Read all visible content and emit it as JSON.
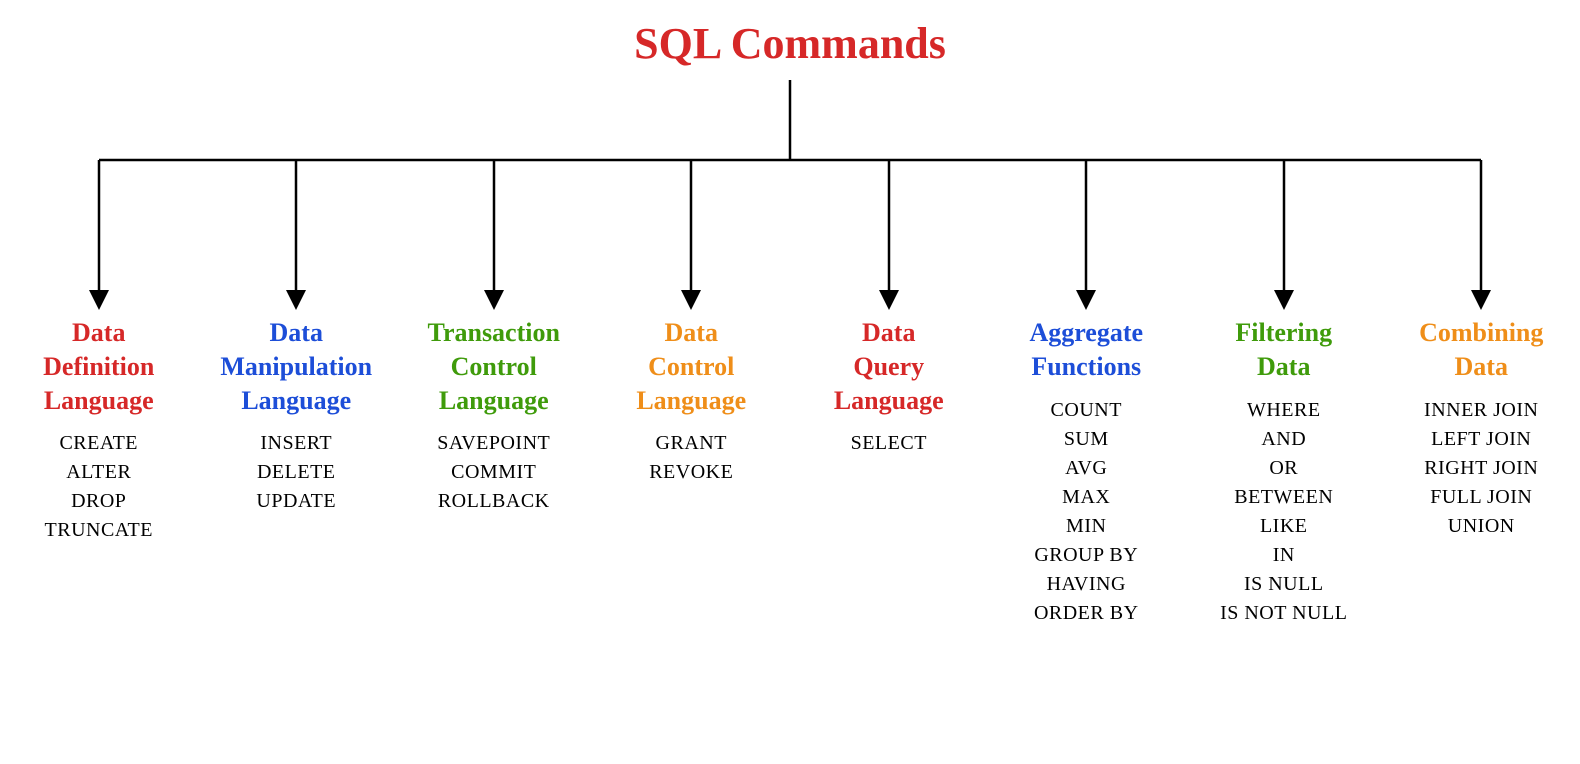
{
  "title": "SQL Commands",
  "categories": [
    {
      "titleLines": [
        "Data",
        "Definition",
        "Language"
      ],
      "color": "c-red",
      "commands": [
        "CREATE",
        "ALTER",
        "DROP",
        "TRUNCATE"
      ]
    },
    {
      "titleLines": [
        "Data",
        "Manipulation",
        "Language"
      ],
      "color": "c-blue",
      "commands": [
        "INSERT",
        "DELETE",
        "UPDATE"
      ]
    },
    {
      "titleLines": [
        "Transaction",
        "Control",
        "Language"
      ],
      "color": "c-green",
      "commands": [
        "SAVEPOINT",
        "COMMIT",
        "ROLLBACK"
      ]
    },
    {
      "titleLines": [
        "Data",
        "Control",
        "Language"
      ],
      "color": "c-orange",
      "commands": [
        "GRANT",
        "REVOKE"
      ]
    },
    {
      "titleLines": [
        "Data",
        "Query",
        "Language"
      ],
      "color": "c-red",
      "commands": [
        "SELECT"
      ]
    },
    {
      "titleLines": [
        "Aggregate",
        "Functions"
      ],
      "color": "c-blue",
      "commands": [
        "COUNT",
        "SUM",
        "AVG",
        "MAX",
        "MIN",
        "GROUP BY",
        "HAVING",
        "ORDER BY"
      ]
    },
    {
      "titleLines": [
        "Filtering",
        "Data"
      ],
      "color": "c-green",
      "commands": [
        "WHERE",
        "AND",
        "OR",
        "BETWEEN",
        "LIKE",
        "IN",
        "IS NULL",
        "IS NOT NULL"
      ]
    },
    {
      "titleLines": [
        "Combining",
        "Data"
      ],
      "color": "c-orange",
      "commands": [
        "INNER JOIN",
        "LEFT JOIN",
        "RIGHT JOIN",
        "FULL JOIN",
        "UNION"
      ]
    }
  ],
  "layout": {
    "childXs": [
      99,
      296,
      494,
      691,
      889,
      1086,
      1284,
      1481
    ],
    "rootX": 790,
    "rootTopY": 80,
    "horizY": 160,
    "arrowBottomY": 300
  }
}
